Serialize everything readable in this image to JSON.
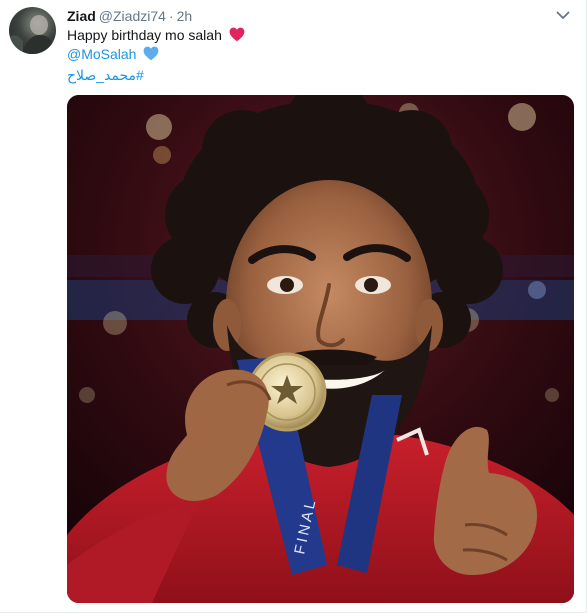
{
  "tweet": {
    "author_name": "Ziad",
    "author_handle": "@Ziadzi74",
    "separator": "·",
    "timestamp": "2h",
    "text": "Happy birthday mo salah",
    "mention": "@MoSalah",
    "hashtag": "#محمد_صلاح",
    "heart_color": "#e0245e",
    "blue_heart_color": "#5dadec",
    "link_color": "#1b95e0",
    "photo_alt": "Photo"
  },
  "icons": {
    "caret": "chevron-down-icon",
    "heart": "red-heart-icon",
    "blue_heart": "blue-heart-icon"
  }
}
